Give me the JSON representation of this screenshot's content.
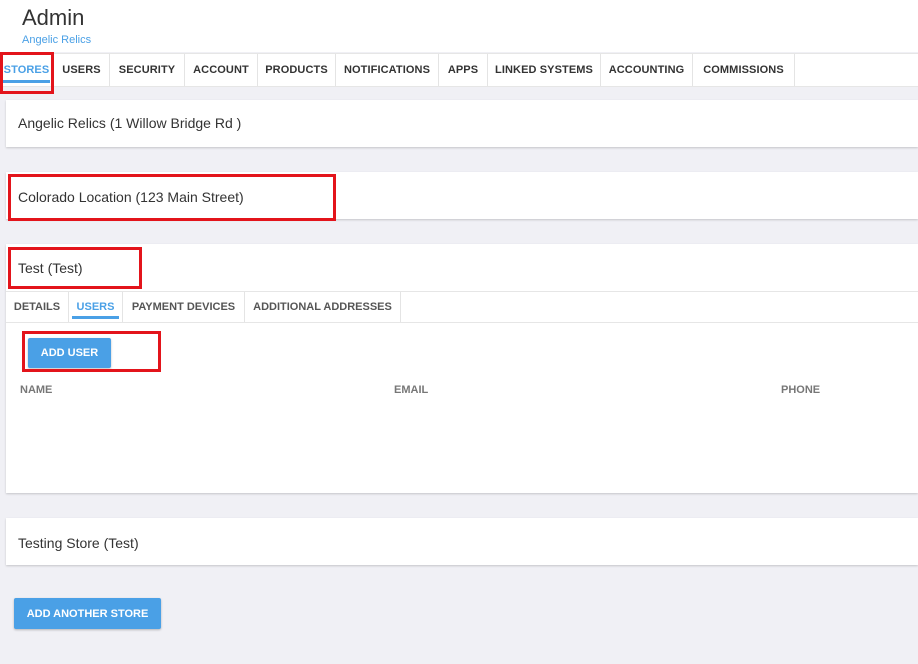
{
  "header": {
    "title": "Admin",
    "subtitle": "Angelic Relics"
  },
  "tabs": [
    {
      "label": "STORES",
      "active": true
    },
    {
      "label": "USERS"
    },
    {
      "label": "SECURITY"
    },
    {
      "label": "ACCOUNT"
    },
    {
      "label": "PRODUCTS"
    },
    {
      "label": "NOTIFICATIONS"
    },
    {
      "label": "APPS"
    },
    {
      "label": "LINKED SYSTEMS"
    },
    {
      "label": "ACCOUNTING"
    },
    {
      "label": "COMMISSIONS"
    }
  ],
  "stores": [
    {
      "name": "Angelic Relics (1 Willow Bridge Rd )"
    },
    {
      "name": "Colorado Location (123 Main Street)"
    },
    {
      "name": "Test (Test)"
    },
    {
      "name": "Testing Store (Test)"
    }
  ],
  "store_detail": {
    "subtabs": [
      {
        "label": "DETAILS"
      },
      {
        "label": "USERS",
        "active": true
      },
      {
        "label": "PAYMENT DEVICES"
      },
      {
        "label": "ADDITIONAL ADDRESSES"
      }
    ],
    "add_user_label": "ADD USER",
    "columns": [
      "NAME",
      "EMAIL",
      "PHONE"
    ]
  },
  "add_store_label": "ADD ANOTHER STORE",
  "colors": {
    "accent": "#4aa0e6",
    "highlight": "#e3141b",
    "background": "#f0f0f5"
  }
}
